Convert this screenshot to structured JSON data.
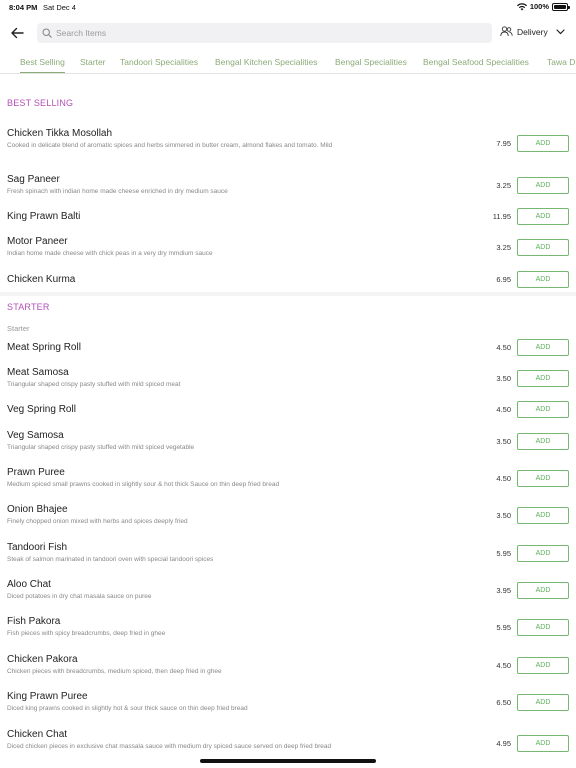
{
  "status_bar": {
    "time": "8:04 PM",
    "date": "Sat Dec 4",
    "battery": "100%"
  },
  "header": {
    "search_placeholder": "Search Items",
    "delivery_label": "Delivery",
    "icons": {
      "back": "arrow-left-icon",
      "search": "search-icon",
      "delivery": "people-icon",
      "dropdown": "chevron-down-icon"
    }
  },
  "tabs": [
    {
      "label": "Best Selling",
      "active": true
    },
    {
      "label": "Starter"
    },
    {
      "label": "Tandoori Specialities"
    },
    {
      "label": "Bengal Kitchen Specialities"
    },
    {
      "label": "Bengal Specialities"
    },
    {
      "label": "Bengal Seafood Specialities"
    },
    {
      "label": "Tawa D"
    }
  ],
  "add_label": "ADD",
  "colors": {
    "accent_green": "#8bab78",
    "section_purple": "#b450b8",
    "button_green": "#5fae5b"
  },
  "sections": [
    {
      "title": "BEST SELLING",
      "items": [
        {
          "name": "Chicken Tikka Mosollah",
          "desc": "Cooked in delicate blend of aromatic spices and herbs simmered in butter cream, almond flakes and tomato. Mild",
          "price": "7.95"
        },
        {
          "name": "Sag Paneer",
          "desc": "Fresh spinach with indian home made cheese enriched in dry medium sauce",
          "price": "3.25"
        },
        {
          "name": "King Prawn Balti",
          "desc": "",
          "price": "11.95"
        },
        {
          "name": "Motor Paneer",
          "desc": "Indian home made cheese with chick peas in a very dry mmdium sauce",
          "price": "3.25"
        },
        {
          "name": "Chicken Kurma",
          "desc": "",
          "price": "6.95"
        }
      ]
    },
    {
      "title": "STARTER",
      "sub_label": "Starter",
      "items": [
        {
          "name": "Meat Spring Roll",
          "desc": "",
          "price": "4.50"
        },
        {
          "name": "Meat Samosa",
          "desc": "Triangular shaped crispy pasty stuffed with mild spiced meat",
          "price": "3.50"
        },
        {
          "name": "Veg Spring Roll",
          "desc": "",
          "price": "4.50"
        },
        {
          "name": "Veg Samosa",
          "desc": "Triangular shaped crispy pasty stuffed with mild spiced vegetable",
          "price": "3.50"
        },
        {
          "name": "Prawn Puree",
          "desc": "Medium spiced small prawns cooked in slightly sour & hot thick Sauce on thin deep fried bread",
          "price": "4.50"
        },
        {
          "name": "Onion Bhajee",
          "desc": "Finely chopped onion mixed with herbs and spices deeply fried",
          "price": "3.50"
        },
        {
          "name": "Tandoori Fish",
          "desc": "Steak of salmon marinated in tandoori oven with special tandoori spices",
          "price": "5.95"
        },
        {
          "name": "Aloo Chat",
          "desc": "Diced potatoes in dry chat masala sauce on puree",
          "price": "3.95"
        },
        {
          "name": "Fish Pakora",
          "desc": "Fish pieces with spicy breadcrumbs, deep fried in ghee",
          "price": "5.95"
        },
        {
          "name": "Chicken Pakora",
          "desc": "Chicken pieces with breadcrumbs, medium spiced, then deep fried in ghee",
          "price": "4.50"
        },
        {
          "name": "King Prawn Puree",
          "desc": "Diced king prawns cooked in slightly hot & sour thick sauce on thin deep fried bread",
          "price": "6.50"
        },
        {
          "name": "Chicken Chat",
          "desc": "Diced chicken pieces in exclusive chat massala sauce with medium dry spiced sauce served on deep fried bread",
          "price": "4.95"
        }
      ]
    }
  ]
}
